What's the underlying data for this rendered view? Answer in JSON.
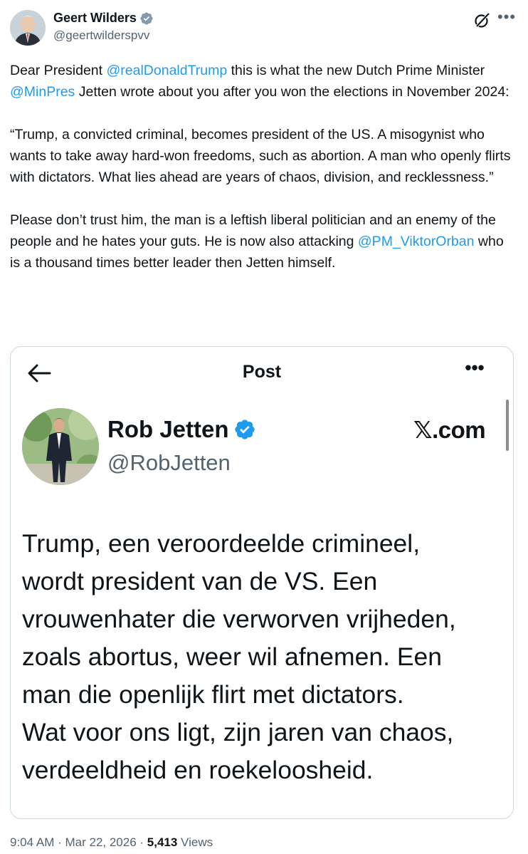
{
  "author": {
    "name": "Geert Wilders",
    "handle": "@geertwilderspvv",
    "verified": true
  },
  "tweet": {
    "p1": [
      {
        "t": "Dear President ",
        "m": false
      },
      {
        "t": "@realDonaldTrump",
        "m": true
      },
      {
        "t": " this is what the new Dutch Prime Minister ",
        "m": false
      },
      {
        "t": "@MinPres",
        "m": true
      },
      {
        "t": " Jetten wrote about you after you won the elections in November 2024:",
        "m": false
      }
    ],
    "p2": "“Trump, a convicted criminal, becomes president of the US. A misogynist who wants to take away hard-won freedoms, such as abortion. A man who openly flirts with dictators. What lies ahead are years of chaos, division, and recklessness.”",
    "p3": [
      {
        "t": "Please don’t trust him, the man is a leftish liberal politician and an enemy of the people and he hates your guts. He is now also attacking ",
        "m": false
      },
      {
        "t": "@PM_ViktorOrban",
        "m": true
      },
      {
        "t": " who is a thousand times better leader then Jetten himself.",
        "m": false
      }
    ]
  },
  "embedded": {
    "header_title": "Post",
    "author_name": "Rob Jetten",
    "author_handle": "@RobJetten",
    "source_prefix": "𝕏",
    "source_suffix": ".com",
    "lines": [
      "Trump, een veroordeelde crimineel,",
      "wordt president van de VS. Een",
      "vrouwenhater die verworven vrijheden,",
      "zoals abortus, weer wil afnemen. Een",
      "man die openlijk flirt met dictators.",
      "Wat voor ons ligt, zijn jaren van chaos,",
      "verdeeldheid en roekeloosheid."
    ]
  },
  "meta": {
    "time": "9:04 AM",
    "date": "Mar 22, 2026",
    "sep": " · ",
    "views_count": "5,413",
    "views_label": " Views"
  },
  "colors": {
    "accent": "#1d9bf0",
    "text": "#0f1419",
    "muted": "#536471"
  },
  "icons": {
    "verified": "verified-badge-icon",
    "grok": "grok-icon",
    "more": "more-icon",
    "back": "back-arrow-icon"
  }
}
